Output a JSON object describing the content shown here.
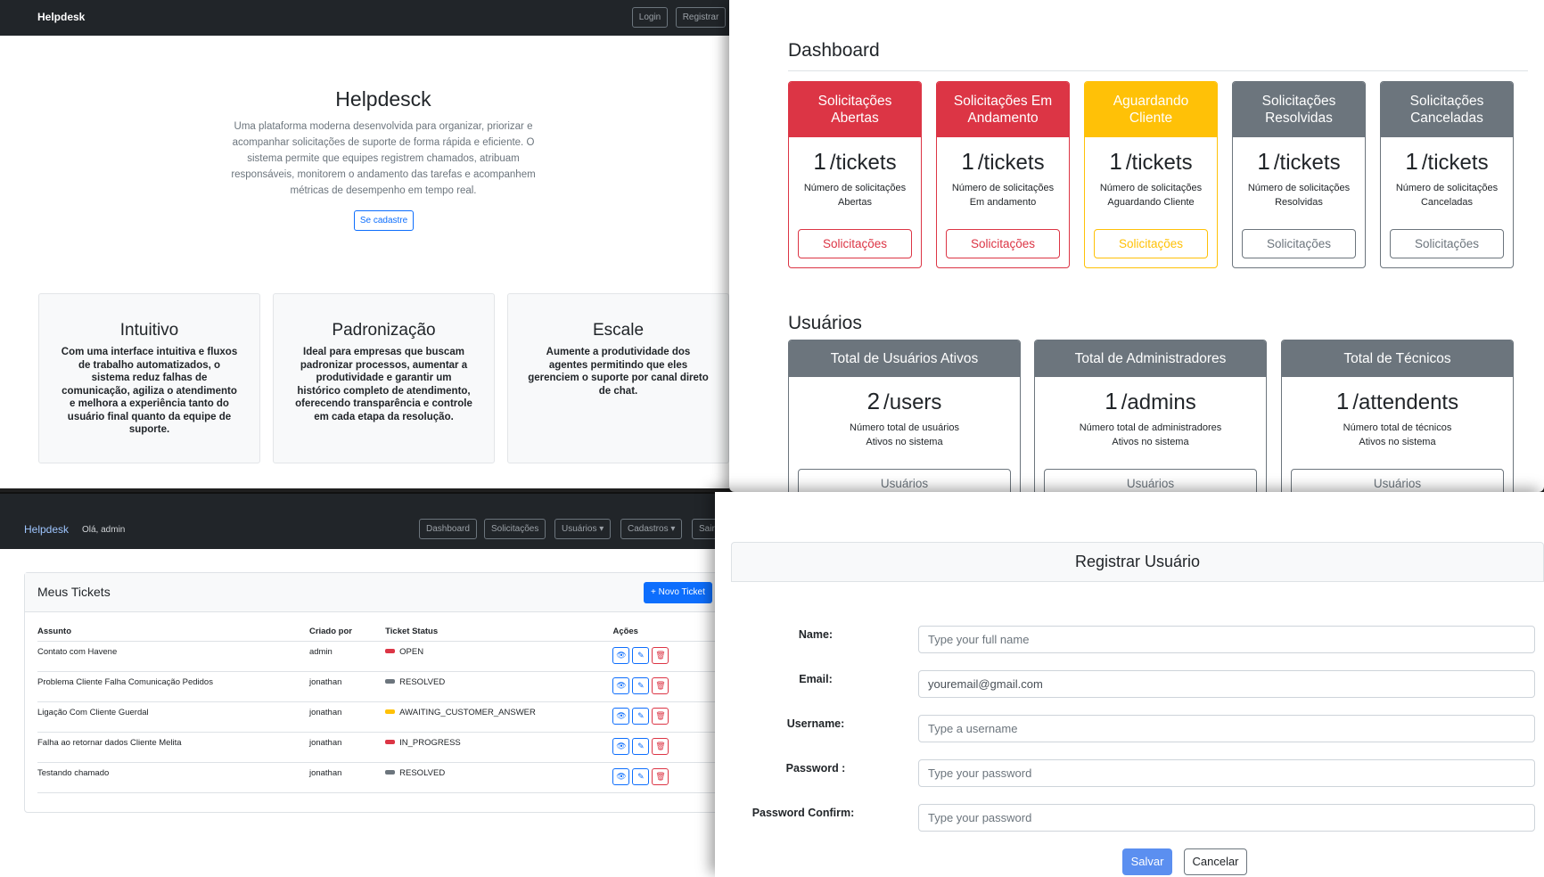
{
  "landing": {
    "brand": "Helpdesk",
    "login": "Login",
    "register": "Registrar",
    "title": "Helpdesck",
    "description": "Uma plataforma moderna desenvolvida para organizar, priorizar e acompanhar solicitações de suporte de forma rápida e eficiente. O sistema permite que equipes registrem chamados, atribuam responsáveis, monitorem o andamento das tarefas e acompanhem métricas de desempenho em tempo real.",
    "cta": "Se cadastre",
    "features": [
      {
        "title": "Intuitivo",
        "text": "Com uma interface intuitiva e fluxos de trabalho automatizados, o sistema reduz falhas de comunicação, agiliza o atendimento e melhora a experiência tanto do usuário final quanto da equipe de suporte."
      },
      {
        "title": "Padronização",
        "text": "Ideal para empresas que buscam padronizar processos, aumentar a produtividade e garantir um histórico completo de atendimento, oferecendo transparência e controle em cada etapa da resolução."
      },
      {
        "title": "Escale",
        "text": "Aumente a produtividade dos agentes permitindo que eles gerenciem o suporte por canal direto de chat."
      }
    ]
  },
  "dashboard": {
    "title": "Dashboard",
    "ticket_cards": [
      {
        "head": "Solicitações Abertas",
        "count": "1",
        "unit": "/tickets",
        "desc1": "Número de solicitações",
        "desc2": "Abertas",
        "button": "Solicitações",
        "color": "#dc3545"
      },
      {
        "head": "Solicitações Em Andamento",
        "count": "1",
        "unit": "/tickets",
        "desc1": "Número de solicitações",
        "desc2": "Em andamento",
        "button": "Solicitações",
        "color": "#dc3545"
      },
      {
        "head": "Aguardando Cliente",
        "count": "1",
        "unit": "/tickets",
        "desc1": "Número de solicitações",
        "desc2": "Aguardando Cliente",
        "button": "Solicitações",
        "color": "#ffc107"
      },
      {
        "head": "Solicitações Resolvidas",
        "count": "1",
        "unit": "/tickets",
        "desc1": "Número de solicitações",
        "desc2": "Resolvidas",
        "button": "Solicitações",
        "color": "#6c757d"
      },
      {
        "head": "Solicitações Canceladas",
        "count": "1",
        "unit": "/tickets",
        "desc1": "Número de solicitações",
        "desc2": "Canceladas",
        "button": "Solicitações",
        "color": "#6c757d"
      }
    ],
    "users_title": "Usuários",
    "user_cards": [
      {
        "head": "Total de Usuários Ativos",
        "count": "2",
        "unit": "/users",
        "desc1": "Número total de usuários",
        "desc2": "Ativos no sistema",
        "button": "Usuários"
      },
      {
        "head": "Total de Administradores",
        "count": "1",
        "unit": "/admins",
        "desc1": "Número total de administradores",
        "desc2": "Ativos no sistema",
        "button": "Usuários"
      },
      {
        "head": "Total de Técnicos",
        "count": "1",
        "unit": "/attendents",
        "desc1": "Número total de técnicos",
        "desc2": "Ativos no sistema",
        "button": "Usuários"
      }
    ]
  },
  "tickets": {
    "brand": "Helpdesk",
    "greeting": "Olá, admin",
    "nav": {
      "dashboard": "Dashboard",
      "solicitacoes": "Solicitações",
      "usuarios": "Usuários",
      "cadastros": "Cadastros",
      "sair": "Sair"
    },
    "title": "Meus Tickets",
    "new_ticket": "+ Novo Ticket",
    "columns": [
      "Assunto",
      "Criado por",
      "Ticket Status",
      "Ações"
    ],
    "rows": [
      {
        "subject": "Contato com Havene",
        "created_by": "admin",
        "status": "OPEN",
        "status_color": "#dc3545"
      },
      {
        "subject": "Problema Cliente Falha Comunicação Pedidos",
        "created_by": "jonathan",
        "status": "RESOLVED",
        "status_color": "#6c757d"
      },
      {
        "subject": "Ligação Com Cliente Guerdal",
        "created_by": "jonathan",
        "status": "AWAITING_CUSTOMER_ANSWER",
        "status_color": "#ffc107"
      },
      {
        "subject": "Falha ao retornar dados Cliente Melita",
        "created_by": "jonathan",
        "status": "IN_PROGRESS",
        "status_color": "#dc3545"
      },
      {
        "subject": "Testando chamado",
        "created_by": "jonathan",
        "status": "RESOLVED",
        "status_color": "#6c757d"
      }
    ]
  },
  "register": {
    "title": "Registrar Usuário",
    "fields": [
      {
        "label": "Name:",
        "value": "",
        "placeholder": "Type your full name"
      },
      {
        "label": "Email:",
        "value": "youremail@gmail.com",
        "placeholder": ""
      },
      {
        "label": "Username:",
        "value": "",
        "placeholder": "Type a username"
      },
      {
        "label": "Password :",
        "value": "",
        "placeholder": "Type your password"
      },
      {
        "label": "Password Confirm:",
        "value": "",
        "placeholder": "Type your password"
      }
    ],
    "save": "Salvar",
    "cancel": "Cancelar"
  }
}
